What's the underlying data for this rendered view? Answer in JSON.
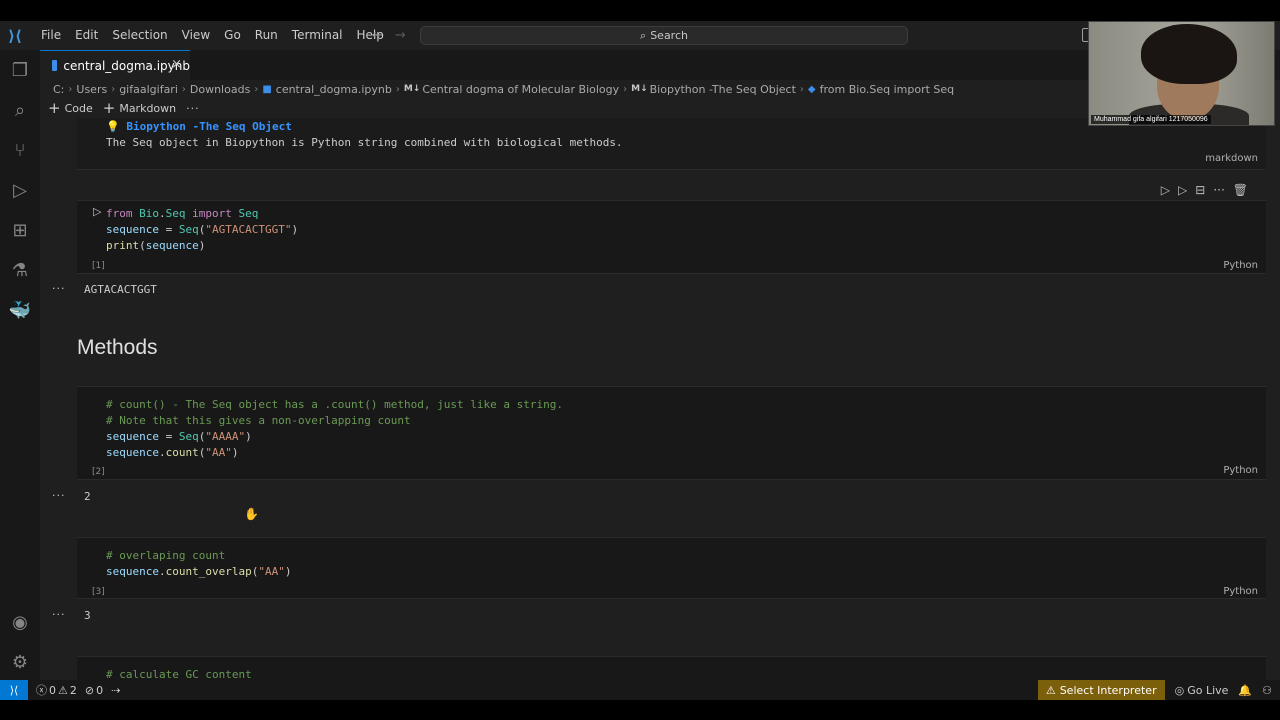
{
  "titlebar": {
    "menu": [
      "File",
      "Edit",
      "Selection",
      "View",
      "Go",
      "Run",
      "Terminal",
      "Help"
    ],
    "search_placeholder": "Search"
  },
  "tab": {
    "title": "central_dogma.ipynb"
  },
  "breadcrumb": {
    "items": [
      "C:",
      "Users",
      "gifaalgifari",
      "Downloads",
      "central_dogma.ipynb",
      "Central dogma of Molecular Biology",
      "Biopython -The Seq Object",
      "from Bio.Seq import Seq"
    ],
    "md_prefix": "M↓"
  },
  "notebook_toolbar": {
    "code_label": "Code",
    "markdown_label": "Markdown",
    "more_label": "···"
  },
  "cells": {
    "markdown1": {
      "title": "Biopython -The Seq Object",
      "text": "The Seq object in Biopython is Python string combined with biological methods.",
      "lang": "markdown"
    },
    "code1": {
      "count": "[1]",
      "lang": "Python",
      "output": "AGTACACTGGT"
    },
    "heading": "Methods",
    "code2": {
      "count": "[2]",
      "lang": "Python",
      "comment1": "# count() - The Seq object has a .count() method, just like a string.",
      "comment2": "# Note that this gives a non-overlapping count",
      "output": "2"
    },
    "code3": {
      "count": "[3]",
      "lang": "Python",
      "comment1": "# overlaping count",
      "output": "3"
    },
    "code4": {
      "comment1": "# calculate GC content"
    }
  },
  "output_dots": "···",
  "statusbar": {
    "errors": "0",
    "warnings": "2",
    "ports": "0",
    "interpreter": "Select Interpreter",
    "golive": "Go Live"
  },
  "webcam": {
    "name": "Muhammad gifa algifari 1217050096"
  },
  "colors": {
    "accent": "#0078d4",
    "interpreter_bg": "#7b5f0b",
    "keyword": "#c586c0",
    "string": "#ce9178",
    "comment": "#6a9955"
  }
}
